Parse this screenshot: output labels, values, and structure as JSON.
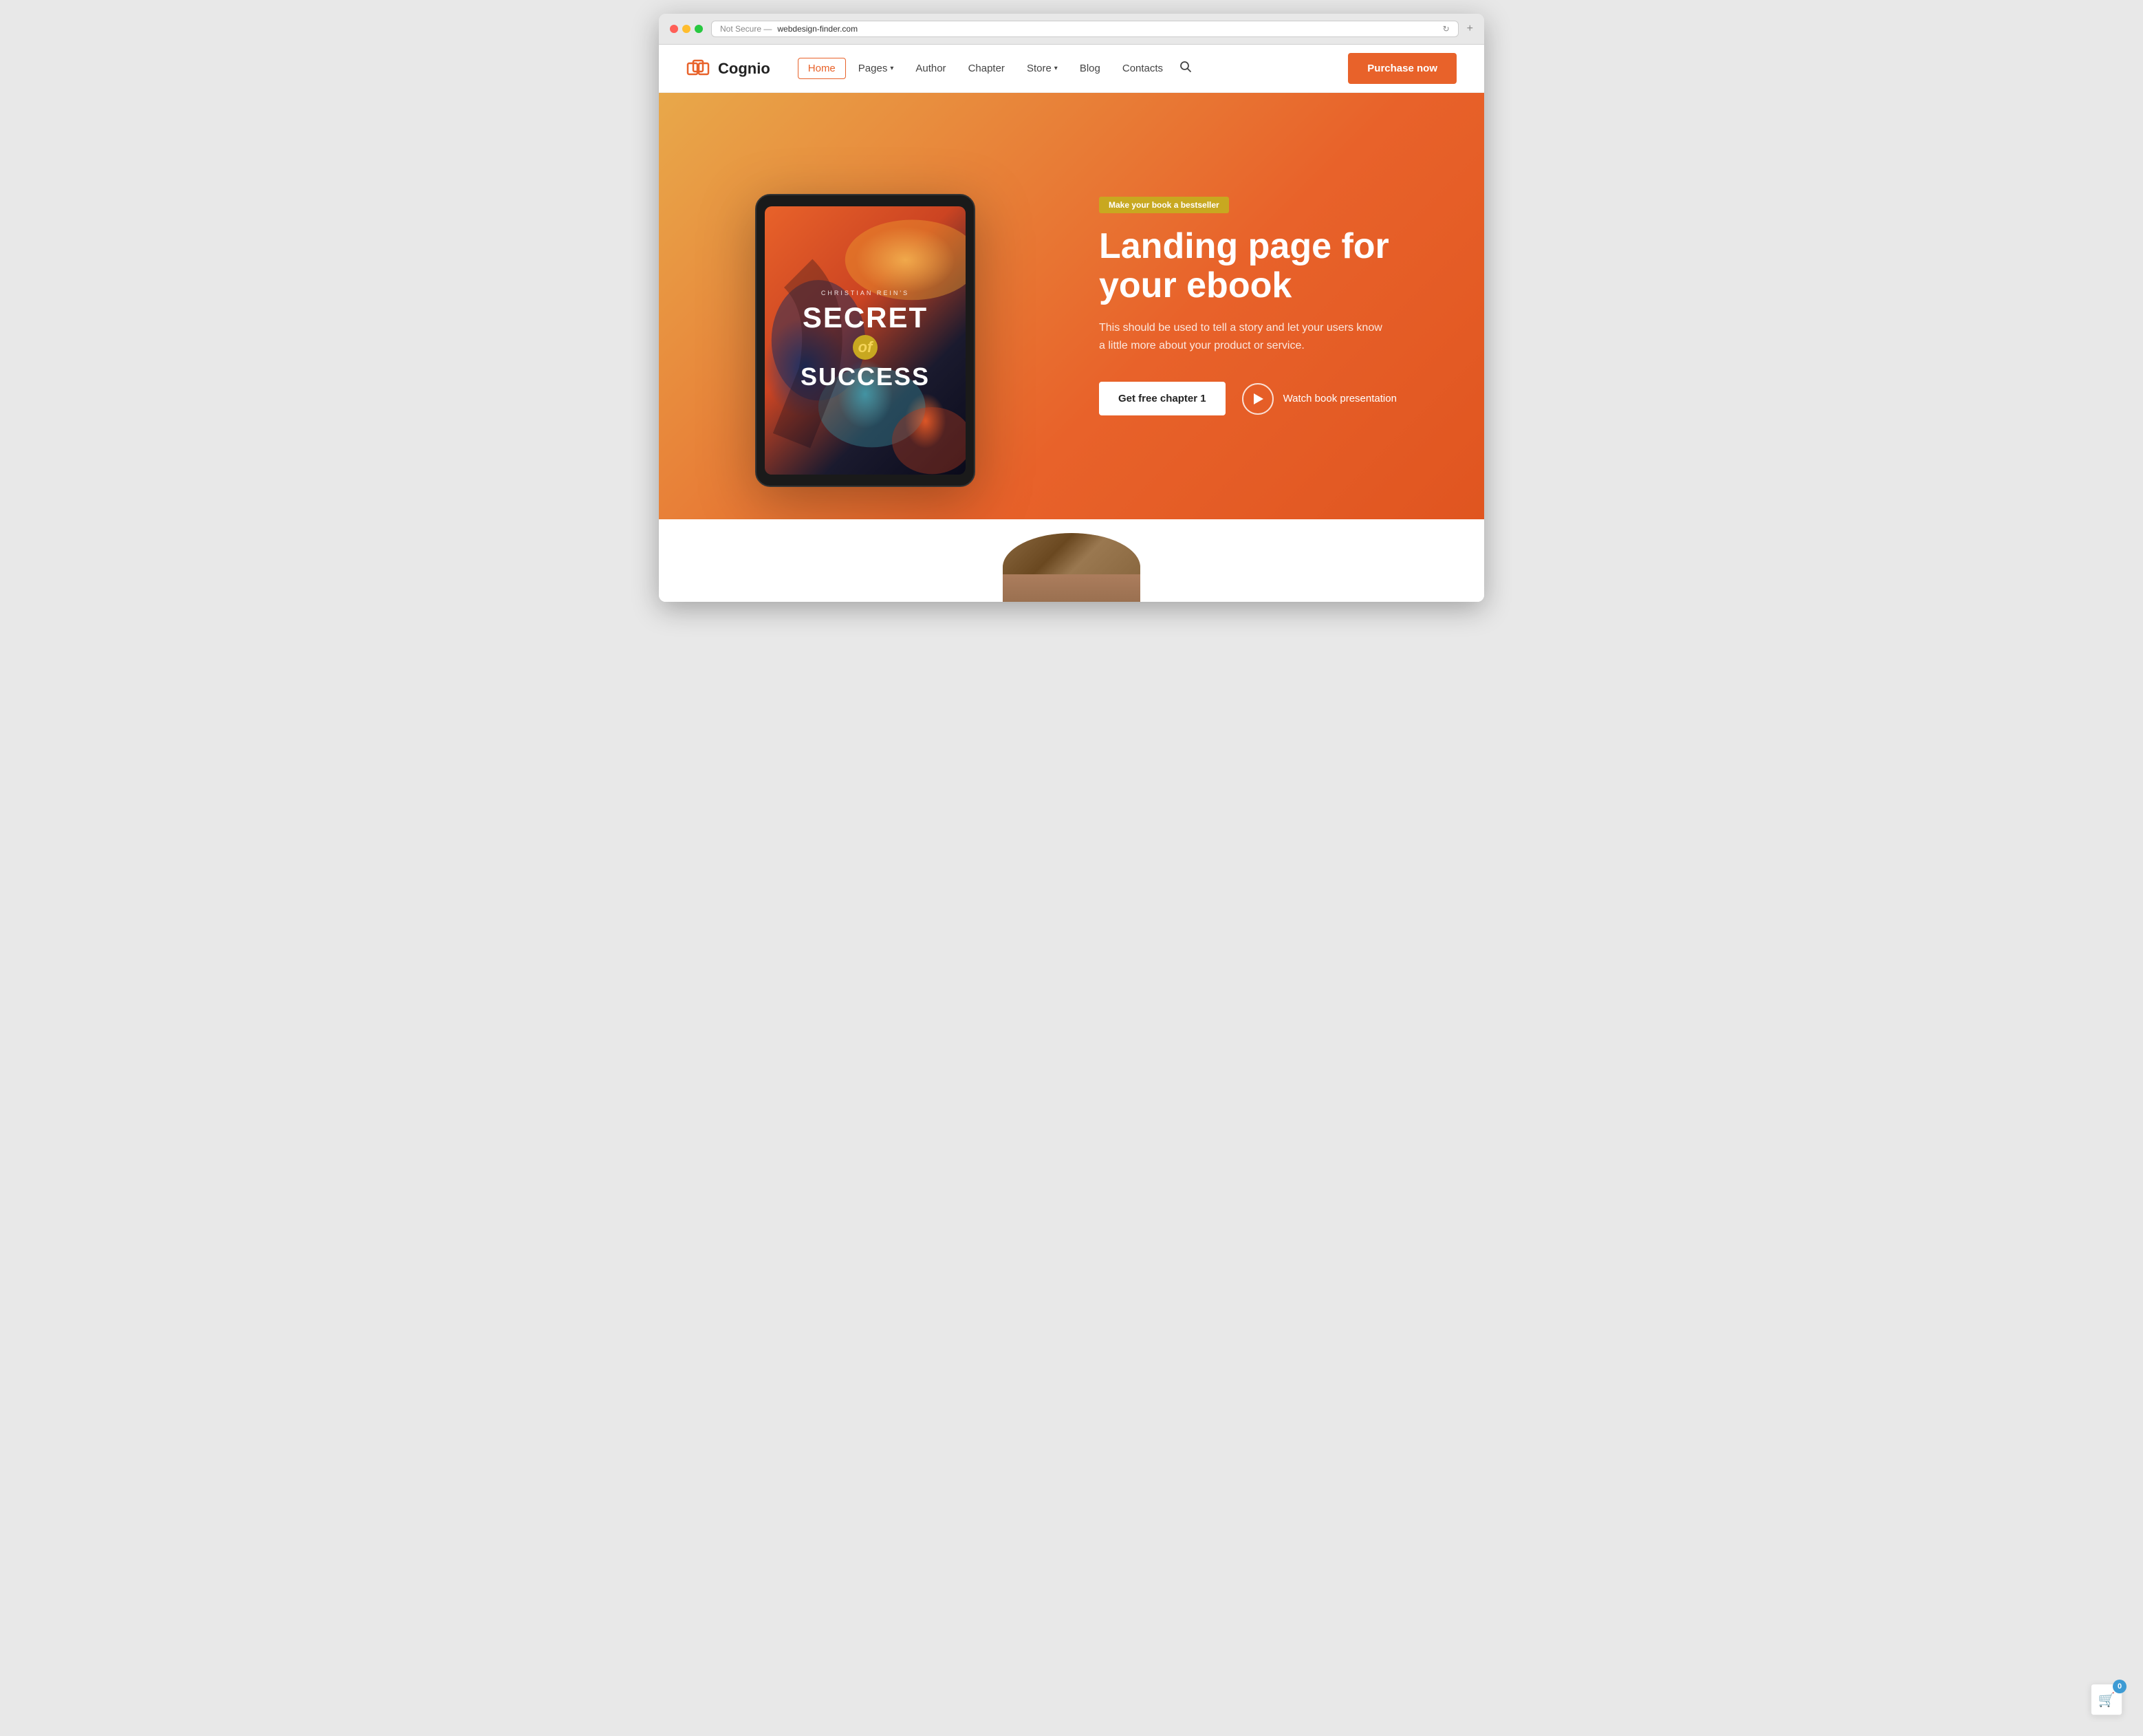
{
  "browser": {
    "url_label": "Not Secure —",
    "url": "webdesign-finder.com"
  },
  "navbar": {
    "logo_text": "Cognio",
    "nav_items": [
      {
        "label": "Home",
        "active": true,
        "has_dropdown": false
      },
      {
        "label": "Pages",
        "active": false,
        "has_dropdown": true
      },
      {
        "label": "Author",
        "active": false,
        "has_dropdown": false
      },
      {
        "label": "Chapter",
        "active": false,
        "has_dropdown": false
      },
      {
        "label": "Store",
        "active": false,
        "has_dropdown": true
      },
      {
        "label": "Blog",
        "active": false,
        "has_dropdown": false
      },
      {
        "label": "Contacts",
        "active": false,
        "has_dropdown": false
      }
    ],
    "purchase_btn": "Purchase now"
  },
  "hero": {
    "badge": "Make your book a bestseller",
    "title": "Landing page for your ebook",
    "description": "This should be used to tell a story and let your users know a little more about your product or service.",
    "cta_primary": "Get free chapter 1",
    "cta_video": "Watch book presentation",
    "book": {
      "author": "Christian Rein's",
      "title_line1": "SECRET",
      "title_of": "of",
      "title_line2": "SUCCESS"
    }
  },
  "cart": {
    "count": "0"
  }
}
